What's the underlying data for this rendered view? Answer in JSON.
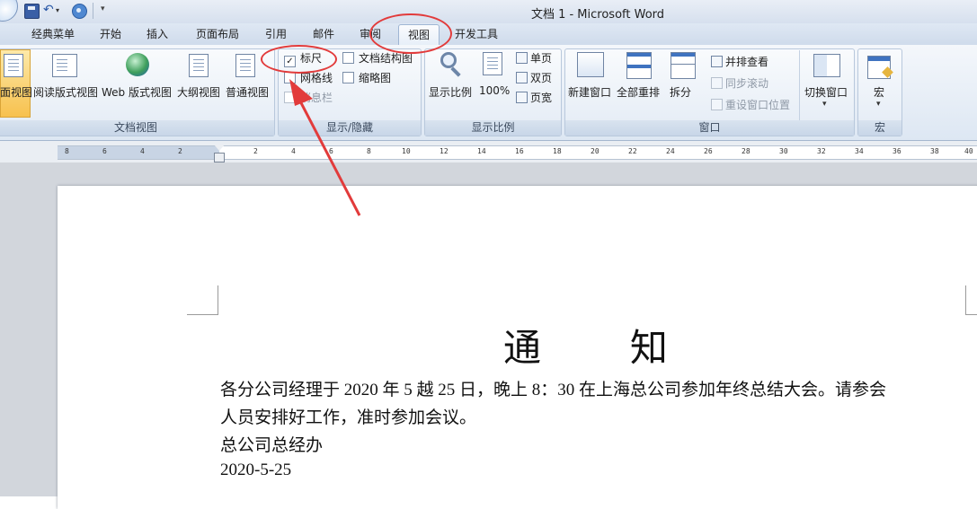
{
  "app": {
    "window_title": "文档 1 - Microsoft Word"
  },
  "quick_access": {
    "customize_glyph": "▾",
    "undo_glyph": "↶",
    "dropdown_glyph": "▾"
  },
  "tabs": [
    "经典菜单",
    "开始",
    "插入",
    "页面布局",
    "引用",
    "邮件",
    "审阅",
    "视图",
    "开发工具"
  ],
  "active_tab": "视图",
  "ribbon": {
    "document_views": {
      "label": "文档视图",
      "buttons": [
        "页面视图",
        "阅读版式视图",
        "Web 版式视图",
        "大纲视图",
        "普通视图"
      ],
      "page_view_visible_text": "面视图"
    },
    "show_hide": {
      "label": "显示/隐藏",
      "ruler": {
        "label": "标尺",
        "checked": true
      },
      "gridlines": {
        "label": "网格线",
        "checked": false
      },
      "message_bar": {
        "label": "消息栏",
        "checked": false
      },
      "document_map": {
        "label": "文档结构图",
        "checked": false
      },
      "thumbnails": {
        "label": "缩略图",
        "checked": false
      }
    },
    "zoom": {
      "label": "显示比例",
      "zoom_button": "显示比例",
      "hundred_percent": "100%",
      "one_page": "单页",
      "two_pages": "双页",
      "page_width": "页宽"
    },
    "window": {
      "label": "窗口",
      "new_window": "新建窗口",
      "arrange_all": "全部重排",
      "split": "拆分",
      "view_side_by_side": "并排查看",
      "sync_scroll": "同步滚动",
      "reset_window_position": "重设窗口位置",
      "switch_windows": "切换窗口",
      "switch_windows_dropdown": "▾"
    },
    "macros": {
      "label": "宏",
      "button": "宏",
      "dropdown": "▾"
    }
  },
  "ruler": {
    "ticks": [
      "8",
      "6",
      "4",
      "2",
      "2",
      "4",
      "6",
      "8",
      "10",
      "12",
      "14",
      "16",
      "18",
      "20",
      "22",
      "24",
      "26",
      "28",
      "30",
      "32",
      "34",
      "36",
      "38",
      "40"
    ]
  },
  "document": {
    "title_chars": [
      "通",
      "知"
    ],
    "paragraph_line1": "各分公司经理于 2020 年 5 越 25 日，晚上 8：30 在上海总公司参加年终总结大会。请参会",
    "paragraph_line2": "人员安排好工作，准时参加会议。",
    "signature": "总公司总经办",
    "date": "2020-5-25"
  },
  "colors": {
    "annotation": "#e23b3b",
    "ribbon_bg": "#dde7f3",
    "active_view_button": "#f7c14e"
  }
}
